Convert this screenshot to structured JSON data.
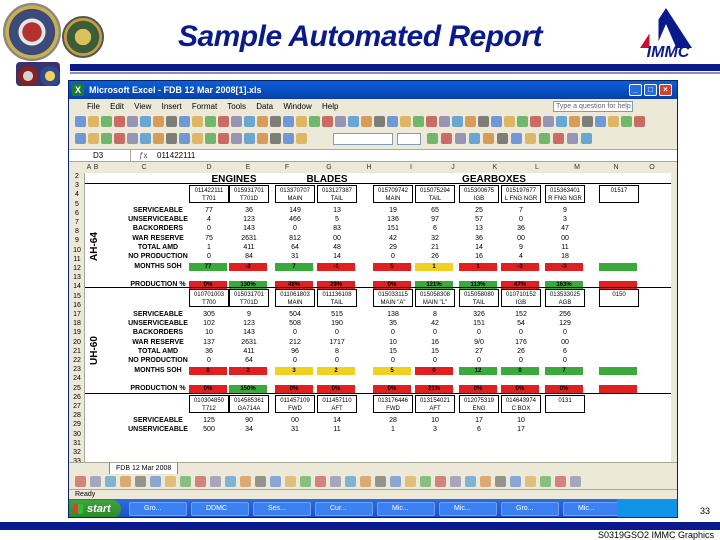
{
  "slide": {
    "title": "Sample Automated Report",
    "logo_text": "IMMC",
    "page_number": "33",
    "footer_text": "S0319GSO2 IMMC Graphics"
  },
  "window": {
    "title": "Microsoft Excel - FDB 12 Mar 2008[1].xls",
    "menu": [
      "File",
      "Edit",
      "View",
      "Insert",
      "Format",
      "Tools",
      "Data",
      "Window",
      "Help"
    ],
    "help_placeholder": "Type a question for help",
    "cell_ref": "D3",
    "formula_value": "011422111",
    "sheet_tab": "FDB 12 Mar 2008",
    "status": "Ready"
  },
  "columns": [
    "A",
    "B",
    "C",
    "D",
    "E",
    "F",
    "G",
    "H",
    "I",
    "J",
    "K",
    "L",
    "M",
    "N",
    "O",
    "P",
    "Q",
    "R"
  ],
  "rows": [
    "2",
    "3",
    "4",
    "5",
    "6",
    "7",
    "8",
    "9",
    "10",
    "11",
    "12",
    "13",
    "14",
    "15",
    "16",
    "17",
    "18",
    "19",
    "20",
    "21",
    "22",
    "23",
    "24",
    "25",
    "26",
    "27",
    "28",
    "29",
    "30",
    "31",
    "32",
    "33"
  ],
  "groups": {
    "engines": "ENGINES",
    "blades": "BLADES",
    "gearboxes": "GEARBOXES"
  },
  "labels": {
    "serviceable": "SERVICEABLE",
    "unserviceable": "UNSERVICEABLE",
    "backorders": "BACKORDERS",
    "war_reserve": "WAR RESERVE",
    "total_amd": "TOTAL AMD",
    "no_production": "NO PRODUCTION",
    "months_soh": "MONTHS SOH",
    "production_pct": "PRODUCTION %"
  },
  "sections": [
    {
      "name": "AH-64",
      "nsn": [
        [
          "011422111",
          "T701"
        ],
        [
          "015931701",
          "T701D"
        ],
        [
          "013370707",
          "MAIN"
        ],
        [
          "013127387",
          "TAIL"
        ],
        [
          "015709742",
          "MAIN"
        ],
        [
          "015075294",
          "TAIL"
        ],
        [
          "015300675",
          "IGB"
        ],
        [
          "015197677",
          "L FNG NGR"
        ],
        [
          "015363401",
          "R FNG NGR"
        ],
        [
          "01517",
          ""
        ]
      ],
      "rows": [
        [
          "77",
          "36",
          "149",
          "13",
          "19",
          "65",
          "25",
          "7",
          "9",
          ""
        ],
        [
          "4",
          "123",
          "466",
          "5",
          "136",
          "97",
          "57",
          "0",
          "3",
          ""
        ],
        [
          "0",
          "143",
          "0",
          "83",
          "151",
          "6",
          "13",
          "36",
          "47",
          ""
        ]
      ],
      "rows2": [
        [
          "75",
          "2631",
          "812",
          "00",
          "42",
          "32",
          "36",
          "00",
          "00",
          ""
        ],
        [
          "1",
          "411",
          "64",
          "48",
          "29",
          "21",
          "14",
          "9",
          "11",
          ""
        ],
        [
          "0",
          "84",
          "31",
          "14",
          "0",
          "26",
          "16",
          "4",
          "18",
          ""
        ]
      ],
      "months_soh": [
        "77",
        "-2",
        "7",
        "-1",
        "5",
        "1",
        "1",
        "-3",
        "-3",
        ""
      ],
      "production": [
        "0%",
        "130%",
        "48%",
        "29%",
        "0%",
        "121%",
        "113%",
        "47%",
        "163%",
        ""
      ],
      "soh_colors": [
        "#3aaa3a",
        "#e02020",
        "#3aaa3a",
        "#e02020",
        "#e02020",
        "#f0d020",
        "#e02020",
        "#e02020",
        "#e02020",
        "#3aaa3a"
      ],
      "prod_colors": [
        "#e02020",
        "#3aaa3a",
        "#e02020",
        "#e02020",
        "#e02020",
        "#3aaa3a",
        "#3aaa3a",
        "#e02020",
        "#3aaa3a",
        "#e02020"
      ]
    },
    {
      "name": "UH-60",
      "nsn": [
        [
          "010701003",
          "T700"
        ],
        [
          "015031701",
          "T701D"
        ],
        [
          "011061803",
          "MAIN"
        ],
        [
          "011136108",
          "TAIL"
        ],
        [
          "015033115",
          "MAIN \"A\""
        ],
        [
          "015058308",
          "MAIN \"L\""
        ],
        [
          "015058080",
          "TAIL"
        ],
        [
          "010710152",
          "IGB"
        ],
        [
          "013533025",
          "AGB"
        ],
        [
          "0150",
          ""
        ]
      ],
      "rows": [
        [
          "305",
          "9",
          "504",
          "515",
          "138",
          "8",
          "326",
          "152",
          "256",
          ""
        ],
        [
          "102",
          "123",
          "508",
          "190",
          "35",
          "42",
          "151",
          "54",
          "129",
          ""
        ],
        [
          "10",
          "143",
          "0",
          "0",
          "0",
          "0",
          "0",
          "0",
          "0",
          ""
        ]
      ],
      "rows2": [
        [
          "137",
          "2631",
          "212",
          "1717",
          "10",
          "16",
          "9/0",
          "176",
          "00",
          ""
        ],
        [
          "36",
          "411",
          "96",
          "8",
          "15",
          "15",
          "27",
          "26",
          "6",
          ""
        ],
        [
          "0",
          "64",
          "0",
          "0",
          "0",
          "0",
          "0",
          "0",
          "0",
          ""
        ]
      ],
      "months_soh": [
        "0",
        "2",
        "3",
        "2",
        "5",
        "0",
        "12",
        "0",
        "7",
        ""
      ],
      "production": [
        "0%",
        "150%",
        "0%",
        "0%",
        "0%",
        "21%",
        "0%",
        "0%",
        "0%",
        ""
      ],
      "soh_colors": [
        "#e02020",
        "#e02020",
        "#f0d020",
        "#f0d020",
        "#f0d020",
        "#e02020",
        "#3aaa3a",
        "#3aaa3a",
        "#3aaa3a",
        "#3aaa3a"
      ],
      "prod_colors": [
        "#e02020",
        "#3aaa3a",
        "#e02020",
        "#e02020",
        "#e02020",
        "#e02020",
        "#e02020",
        "#e02020",
        "#e02020",
        "#e02020"
      ]
    },
    {
      "name": "",
      "nsn": [
        [
          "010304850",
          "T712"
        ],
        [
          "014585361",
          "GA714A"
        ],
        [
          "011457109",
          "FWD"
        ],
        [
          "011457110",
          "AFT"
        ],
        [
          "013176446",
          "FWD"
        ],
        [
          "013154021",
          "AFT"
        ],
        [
          "012075319",
          "ENG"
        ],
        [
          "014643974",
          "C BOX"
        ],
        [
          "0131",
          ""
        ]
      ],
      "rows": [
        [
          "125",
          "90",
          "00",
          "14",
          "28",
          "10",
          "17",
          "10",
          ""
        ],
        [
          "500",
          "34",
          "31",
          "11",
          "1",
          "3",
          "6",
          "17",
          ""
        ]
      ]
    }
  ],
  "taskbar": {
    "start": "start",
    "tasks": [
      "Gro...",
      "DDMC",
      "Ses...",
      "Cur...",
      "Mic...",
      "Mic...",
      "Gro...",
      "Mic..."
    ]
  }
}
